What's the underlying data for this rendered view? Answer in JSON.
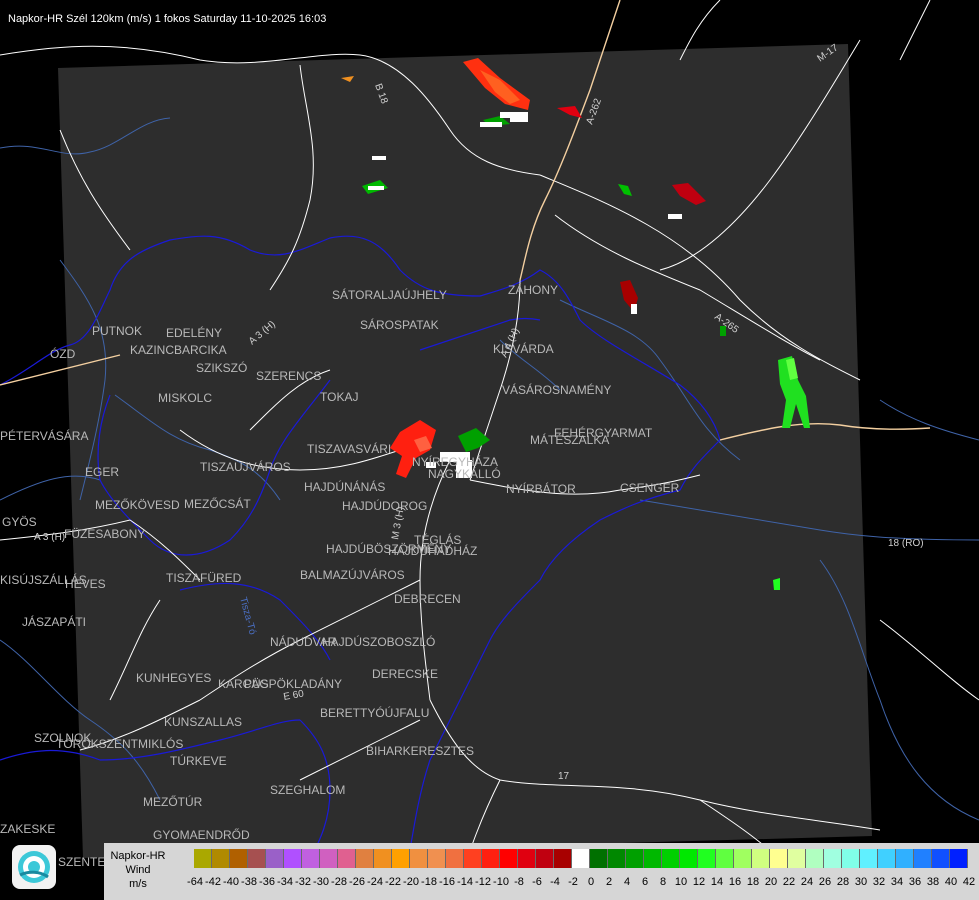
{
  "title": "Napkor-HR Szél 120km (m/s) 1 fokos Saturday 11-10-2025 16:03",
  "legend": {
    "title_line1": "Napkor-HR",
    "title_line2": "Wind",
    "unit": "m/s",
    "colors": [
      "#aaa800",
      "#b08a00",
      "#b06000",
      "#a65050",
      "#9a60c8",
      "#b050ff",
      "#c060e0",
      "#d060c0",
      "#e06090",
      "#e08040",
      "#f09020",
      "#ffa000",
      "#f09040",
      "#f09050",
      "#f07040",
      "#ff4020",
      "#ff2010",
      "#ff0000",
      "#e00010",
      "#c00010",
      "#a80000",
      "#ffffff",
      "#007000",
      "#008800",
      "#00a000",
      "#00b800",
      "#00d000",
      "#00e800",
      "#20ff20",
      "#60ff40",
      "#a0ff60",
      "#d0ff80",
      "#ffff90",
      "#e0ffa0",
      "#b0ffc0",
      "#a0ffe0",
      "#80ffe8",
      "#60f0ff",
      "#40d0ff",
      "#30b0ff",
      "#2080ff",
      "#1050ff",
      "#0020ff"
    ],
    "labels": [
      "-64",
      "-42",
      "-40",
      "-38",
      "-36",
      "-34",
      "-32",
      "-30",
      "-28",
      "-26",
      "-24",
      "-22",
      "-20",
      "-18",
      "-16",
      "-14",
      "-12",
      "-10",
      "-8",
      "-6",
      "-4",
      "-2",
      "0",
      "2",
      "4",
      "6",
      "8",
      "10",
      "12",
      "14",
      "16",
      "18",
      "20",
      "22",
      "24",
      "26",
      "28",
      "30",
      "32",
      "34",
      "36",
      "38",
      "40",
      "42"
    ]
  },
  "cities": [
    {
      "name": "SÁTORALJAÚJHELY"
    },
    {
      "name": "SÁROSPATAK"
    },
    {
      "name": "ZÁHONY"
    },
    {
      "name": "KISVÁRDA"
    },
    {
      "name": "VÁSÁROSNAMÉNY"
    },
    {
      "name": "FEHÉRGYARMAT"
    },
    {
      "name": "MÁTÉSZALKA"
    },
    {
      "name": "NYÍRBÁTOR"
    },
    {
      "name": "CSENGER"
    },
    {
      "name": "PUTNOK"
    },
    {
      "name": "EDELÉNY"
    },
    {
      "name": "KAZINCBARCIKA"
    },
    {
      "name": "SZIKSZÓ"
    },
    {
      "name": "SZERENCS"
    },
    {
      "name": "MISKOLC"
    },
    {
      "name": "TOKAJ"
    },
    {
      "name": "TISZAVASVÁRI"
    },
    {
      "name": "NYÍREGYHÁZA"
    },
    {
      "name": "NAGYKÁLLÓ"
    },
    {
      "name": "HAJDÚNÁNÁS"
    },
    {
      "name": "HAJDÚDOROG"
    },
    {
      "name": "TISZAÚJVÁROS"
    },
    {
      "name": "EGER"
    },
    {
      "name": "MEZŐKÖVESD"
    },
    {
      "name": "MEZŐCSÁT"
    },
    {
      "name": "FÜZESABONY"
    },
    {
      "name": "PÉTERVÁSÁRA"
    },
    {
      "name": "GYÖS"
    },
    {
      "name": "HEVES"
    },
    {
      "name": "JÁSZAPÁTI"
    },
    {
      "name": "TISZAFÜRED"
    },
    {
      "name": "HAJDÚBÖSZÖRMÉNY"
    },
    {
      "name": "HAJDÚHADHÁZ"
    },
    {
      "name": "TÉGLÁS"
    },
    {
      "name": "BALMAZÚJVÁROS"
    },
    {
      "name": "DEBRECEN"
    },
    {
      "name": "NÁDUDVAR"
    },
    {
      "name": "HAJDÚSZOBOSZLÓ"
    },
    {
      "name": "DERECSKE"
    },
    {
      "name": "KUNHEGYES"
    },
    {
      "name": "KARCAG"
    },
    {
      "name": "PÜSPÖKLADÁNY"
    },
    {
      "name": "BERETTYÓÚJFALU"
    },
    {
      "name": "KUNSZALLAS"
    },
    {
      "name": "SZOLNOK"
    },
    {
      "name": "TÖRÖKSZENTMIKLÓS"
    },
    {
      "name": "TÚRKEVE"
    },
    {
      "name": "BIHARKERESZTES"
    },
    {
      "name": "SZEGHALOM"
    },
    {
      "name": "MEZŐTÚR"
    },
    {
      "name": "GYOMAENDRŐD"
    },
    {
      "name": "ÓZD"
    },
    {
      "name": "KISÚJSZÁLLÁS"
    },
    {
      "name": "ZAKESKE"
    },
    {
      "name": "SZENTES"
    }
  ],
  "roads": [
    "A 3 (H)",
    "A-262",
    "B 18",
    "M-17",
    "A-265",
    "18 (RO)",
    "17",
    "A 4 (H)",
    "A 3 (H)",
    "E 60",
    "M 3 (H)",
    "Tisza-Tó"
  ],
  "icons": {
    "logo": "napkor-logo"
  },
  "colors": {
    "background": "#000000",
    "radar_area": "#2d2d2d",
    "border": "#1010c8",
    "roads": "#ffffff",
    "major_road": "#f0c890",
    "rivers": "#3a5aa0"
  }
}
